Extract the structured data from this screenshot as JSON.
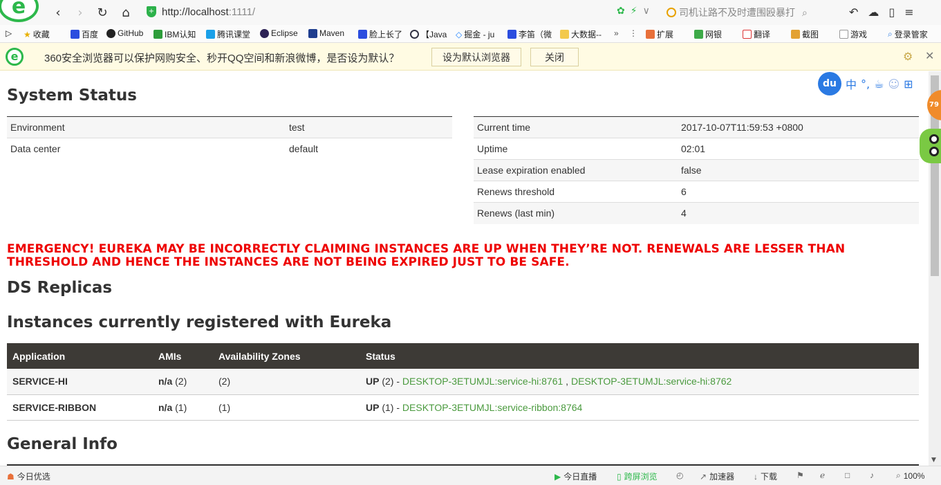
{
  "browser": {
    "url_host": "http://localhost",
    "url_port": ":1111/",
    "search_placeholder": "司机让路不及时遭围殴暴打",
    "bookmarks": [
      "收藏",
      "百度",
      "GitHub",
      "IBM认知",
      "腾讯课堂",
      "Eclipse",
      "Maven",
      "脸上长了",
      "【Java",
      "掘金 - ju",
      "李笛（微",
      "大数据--",
      "扩展",
      "网银",
      "翻译",
      "截图",
      "游戏",
      "登录管家"
    ],
    "notify_text": "360安全浏览器可以保护网购安全、秒开QQ空间和新浪微博，是否设为默认？",
    "notify_set_default": "设为默认浏览器",
    "notify_close": "关闭",
    "baidu_label": "du",
    "baidu_zh": "中",
    "side_badge": "79",
    "status": {
      "left": "今日优选",
      "live": "今日直播",
      "cross": "跨屏浏览",
      "accel": "加速器",
      "download": "下载",
      "zoom": "100%"
    }
  },
  "page": {
    "system_status_title": "System Status",
    "left_table": [
      {
        "key": "Environment",
        "value": "test"
      },
      {
        "key": "Data center",
        "value": "default"
      }
    ],
    "right_table": [
      {
        "key": "Current time",
        "value": "2017-10-07T11:59:53 +0800"
      },
      {
        "key": "Uptime",
        "value": "02:01"
      },
      {
        "key": "Lease expiration enabled",
        "value": "false"
      },
      {
        "key": "Renews threshold",
        "value": "6"
      },
      {
        "key": "Renews (last min)",
        "value": "4"
      }
    ],
    "emergency": "EMERGENCY! EUREKA MAY BE INCORRECTLY CLAIMING INSTANCES ARE UP WHEN THEY’RE NOT. RENEWALS ARE LESSER THAN THRESHOLD AND HENCE THE INSTANCES ARE NOT BEING EXPIRED JUST TO BE SAFE.",
    "ds_replicas_title": "DS Replicas",
    "instances_title": "Instances currently registered with Eureka",
    "instances_headers": [
      "Application",
      "AMIs",
      "Availability Zones",
      "Status"
    ],
    "instances": [
      {
        "application": "SERVICE-HI",
        "ami_bold": "n/a",
        "ami_count": "(2)",
        "zones": "(2)",
        "status_bold": "UP",
        "status_count": "(2) - ",
        "link1": "DESKTOP-3ETUMJL:service-hi:8761",
        "sep": " , ",
        "link2": "DESKTOP-3ETUMJL:service-hi:8762"
      },
      {
        "application": "SERVICE-RIBBON",
        "ami_bold": "n/a",
        "ami_count": "(1)",
        "zones": "(1)",
        "status_bold": "UP",
        "status_count": "(1) - ",
        "link1": "DESKTOP-3ETUMJL:service-ribbon:8764",
        "sep": "",
        "link2": ""
      }
    ],
    "general_info_title": "General Info"
  }
}
